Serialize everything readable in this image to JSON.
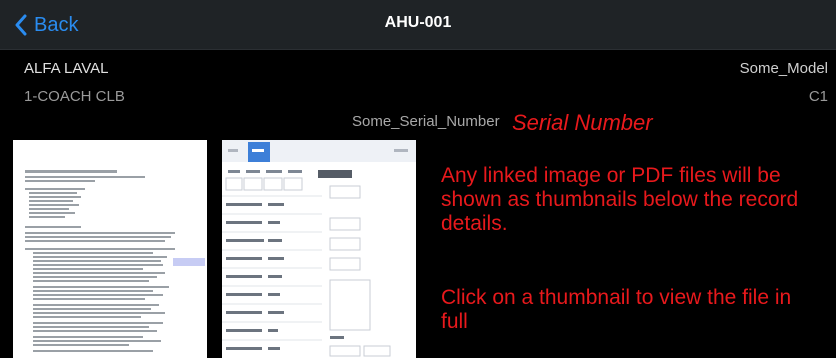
{
  "nav": {
    "back_label": "Back",
    "title": "AHU-001"
  },
  "record": {
    "manufacturer": "ALFA LAVAL",
    "model": "Some_Model",
    "name": "1-COACH CLB",
    "code": "C1",
    "serial_number": "Some_Serial_Number"
  },
  "annotations": {
    "serial_label": "Serial Number",
    "thumbnails_note": "Any linked image or PDF files will be shown as thumbnails below the record details.",
    "click_note": "Click on a thumbnail to view the file in full"
  },
  "thumbnails": [
    {
      "type": "pdf",
      "icon": "document-page"
    },
    {
      "type": "image",
      "icon": "form-screenshot"
    }
  ],
  "colors": {
    "accent": "#2a8cf0",
    "annotation": "#e8191c",
    "navbar": "#1f2326",
    "background": "#000000"
  }
}
